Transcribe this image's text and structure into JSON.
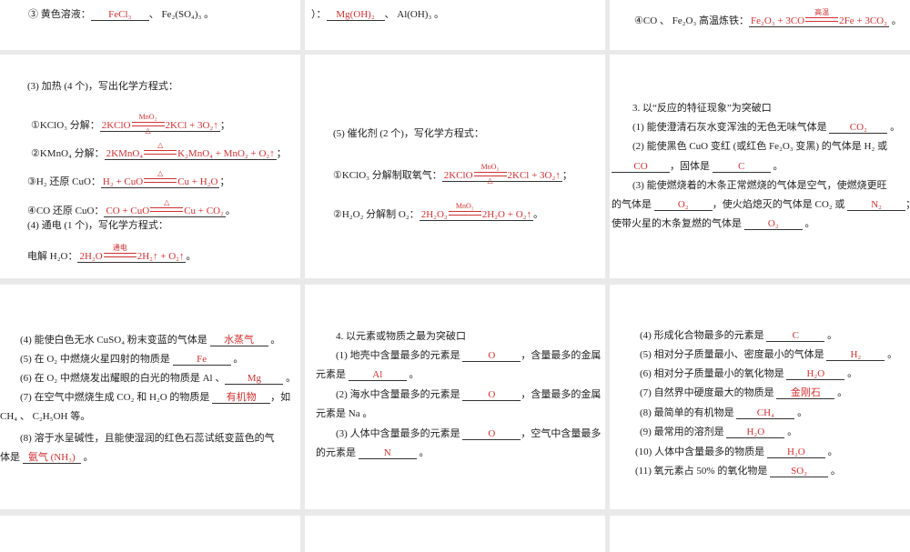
{
  "colors": {
    "answer": "#d03030",
    "gap": "#e9e9e9"
  },
  "lines": [
    {
      "segs": [
        "③ 黄色溶液：",
        {
          "a": "FeCl₃"
        },
        "、 Fe₂(SO₄)₃ 。"
      ]
    },
    {
      "segs": [
        "）：",
        {
          "a": "Mg(OH)₂"
        },
        "、 Al(OH)₃ 。"
      ]
    },
    {
      "segs": [
        "④CO 、 Fe₂O₃ 高温炼铁：",
        {
          "eq": {
            "lhs": "Fe₂O₃ + 3CO",
            "top": "高温",
            "bot": "",
            "rhs": "2Fe + 3CO₂"
          }
        },
        " 。"
      ]
    },
    {
      "segs": [
        "(3) 加热 (4 个)，写出化学方程式："
      ]
    },
    {
      "segs": [
        "①KClO₃ 分解：",
        {
          "eq": {
            "lhs": "2KClO",
            "top": "MnO₂",
            "bot": "△",
            "rhs": "2KCl + 3O₂↑"
          }
        },
        "；"
      ]
    },
    {
      "segs": [
        "②KMnO₄ 分解：",
        {
          "eq": {
            "lhs": "2KMnO₄",
            "top": "△",
            "bot": "",
            "rhs": "K₂MnO₄ + MnO₂ + O₂↑"
          }
        },
        "；"
      ]
    },
    {
      "segs": [
        "③H₂ 还原 CuO：",
        {
          "eq": {
            "lhs": "H₂ + CuO",
            "top": "△",
            "bot": "",
            "rhs": "Cu + H₂O"
          }
        },
        "；"
      ]
    },
    {
      "segs": [
        "④CO 还原 CuO：",
        {
          "eq": {
            "lhs": "CO + CuO",
            "top": "△",
            "bot": "",
            "rhs": "Cu + CO₂"
          }
        },
        "。"
      ]
    },
    {
      "segs": [
        "(4) 通电 (1 个)，写化学方程式："
      ]
    },
    {
      "segs": [
        "电解 H₂O：",
        {
          "eq": {
            "lhs": "2H₂O",
            "top": "通电",
            "bot": "",
            "rhs": "2H₂↑ + O₂↑"
          }
        },
        "。"
      ]
    },
    {
      "segs": [
        "(5) 催化剂 (2 个)，写化学方程式："
      ]
    },
    {
      "segs": [
        "①KClO₃ 分解制取氧气：",
        {
          "eq": {
            "lhs": "2KClO",
            "top": "MnO₂",
            "bot": "△",
            "rhs": "2KCl + 3O₂↑"
          }
        },
        "；"
      ]
    },
    {
      "segs": [
        "②H₂O₂ 分解制 O₂：",
        {
          "eq": {
            "lhs": "2H₂O₂",
            "top": "MnO₂",
            "bot": "",
            "rhs": "2H₂O + O₂↑"
          }
        },
        "。"
      ]
    },
    {
      "segs": [
        "3. 以“反应的特征现象”为突破口"
      ]
    },
    {
      "segs": [
        "(1) 能使澄清石灰水变浑浊的无色无味气体是 ",
        {
          "a": "CO₂"
        },
        " 。"
      ]
    },
    {
      "segs": [
        "(2) 能使黑色 CuO 变红 (或红色 Fe₂O₃ 变黑) 的气体是 H₂ 或"
      ]
    },
    {
      "segs": [
        {
          "a": "CO"
        },
        "，固体是 ",
        {
          "a": "C"
        },
        " 。"
      ]
    },
    {
      "segs": [
        "(3) 能使燃烧着的木条正常燃烧的气体是空气，使燃烧更旺"
      ]
    },
    {
      "segs": [
        "的气体是 ",
        {
          "a": "O₂"
        },
        "，使火焰熄灭的气体是 CO₂ 或 ",
        {
          "a": "N₂"
        },
        "；能"
      ]
    },
    {
      "segs": [
        "使带火星的木条复燃的气体是 ",
        {
          "a": "O₂"
        },
        " 。"
      ]
    },
    {
      "segs": [
        "(4) 能使白色无水 CuSO₄ 粉末变蓝的气体是 ",
        {
          "a": "水蒸气"
        },
        " 。"
      ]
    },
    {
      "segs": [
        "(5) 在 O₂ 中燃烧火星四射的物质是 ",
        {
          "a": "Fe"
        },
        " 。"
      ]
    },
    {
      "segs": [
        "(6) 在 O₂ 中燃烧发出耀眼的白光的物质是 Al 、",
        {
          "a": "Mg"
        },
        " 。"
      ]
    },
    {
      "segs": [
        "(7) 在空气中燃烧生成 CO₂ 和 H₂O 的物质是 ",
        {
          "a": "有机物"
        },
        "，如"
      ]
    },
    {
      "segs": [
        "CH₄ 、 C₂H₅OH 等。"
      ]
    },
    {
      "segs": [
        "(8) 溶于水呈碱性，且能使湿润的红色石蕊试纸变蓝色的气"
      ]
    },
    {
      "segs": [
        "体是 ",
        {
          "a": "氨气 (NH₃)"
        },
        " 。"
      ]
    },
    {
      "segs": [
        "4. 以元素或物质之最为突破口"
      ]
    },
    {
      "segs": [
        "(1) 地壳中含量最多的元素是 ",
        {
          "a": "O"
        },
        "，含量最多的金属"
      ]
    },
    {
      "segs": [
        "元素是 ",
        {
          "a": "Al"
        },
        " 。"
      ]
    },
    {
      "segs": [
        "(2) 海水中含量最多的元素是 ",
        {
          "a": "O"
        },
        "，含量最多的金属"
      ]
    },
    {
      "segs": [
        "元素是 Na 。"
      ]
    },
    {
      "segs": [
        "(3) 人体中含量最多的元素是 ",
        {
          "a": "O"
        },
        "，空气中含量最多"
      ]
    },
    {
      "segs": [
        "的元素是 ",
        {
          "a": "N"
        },
        " 。"
      ]
    },
    {
      "segs": [
        "(4) 形成化合物最多的元素是 ",
        {
          "a": "C"
        },
        " 。"
      ]
    },
    {
      "segs": [
        "(5) 相对分子质量最小、密度最小的气体是 ",
        {
          "a": "H₂"
        },
        " 。"
      ]
    },
    {
      "segs": [
        "(6) 相对分子质量最小的氧化物是 ",
        {
          "a": "H₂O"
        },
        " 。"
      ]
    },
    {
      "segs": [
        "(7) 自然界中硬度最大的物质是 ",
        {
          "a": "金刚石"
        },
        " 。"
      ]
    },
    {
      "segs": [
        "(8) 最简单的有机物是 ",
        {
          "a": "CH₄"
        },
        " 。"
      ]
    },
    {
      "segs": [
        "(9) 最常用的溶剂是 ",
        {
          "a": "H₂O"
        },
        " 。"
      ]
    },
    {
      "segs": [
        "(10) 人体中含量最多的物质是 ",
        {
          "a": "H₂O"
        },
        " 。"
      ]
    },
    {
      "segs": [
        "(11) 氧元素占 50% 的氧化物是 ",
        {
          "a": "SO₂"
        },
        " 。"
      ]
    }
  ]
}
